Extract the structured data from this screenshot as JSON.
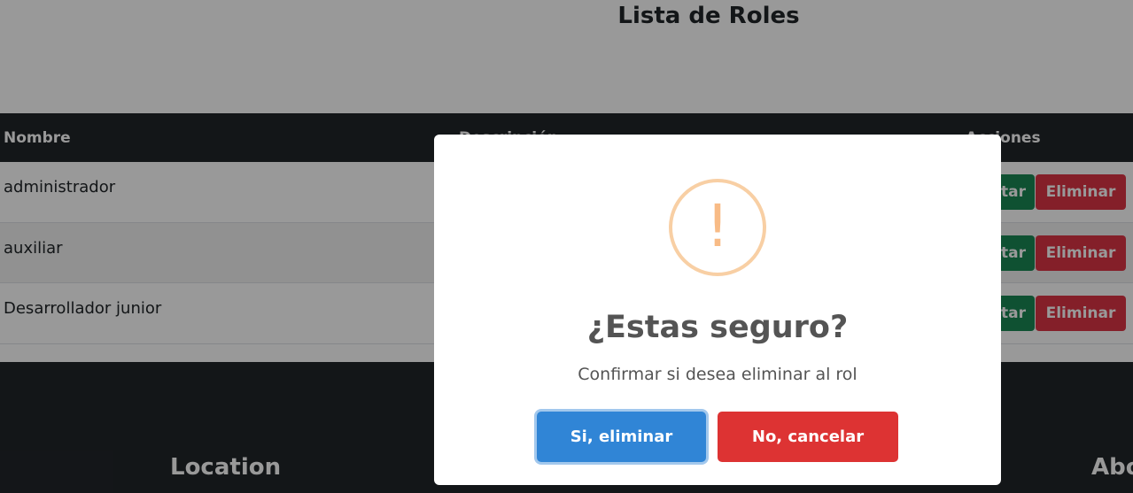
{
  "page": {
    "title": "Lista de Roles"
  },
  "table": {
    "headers": {
      "name": "Nombre",
      "description": "Descripción",
      "actions": "Acciones"
    },
    "rows": [
      {
        "name": "administrador",
        "edit_label": "Editar",
        "delete_label": "Eliminar"
      },
      {
        "name": "auxiliar",
        "edit_label": "Editar",
        "delete_label": "Eliminar"
      },
      {
        "name": "Desarrollador junior",
        "edit_label": "Editar",
        "delete_label": "Eliminar"
      }
    ]
  },
  "footer": {
    "location_heading": "Location",
    "about_heading": "About"
  },
  "dialog": {
    "icon": "warning-icon",
    "icon_glyph": "!",
    "title": "¿Estas seguro?",
    "text": "Confirmar si desea eliminar al rol",
    "confirm_label": "Si, eliminar",
    "cancel_label": "No, cancelar"
  },
  "colors": {
    "confirm": "#3085d6",
    "cancel": "#dd3333",
    "edit": "#198754",
    "delete": "#dc3545",
    "warning": "#f8bb86"
  }
}
